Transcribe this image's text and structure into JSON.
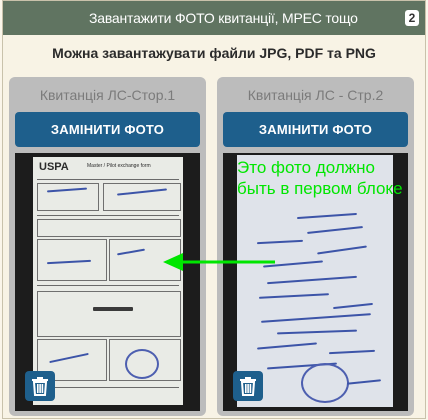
{
  "header": {
    "title": "Завантажити ФОТО квитанції, МРЕС тощо",
    "badge": "2"
  },
  "subtitle": "Можна завантажувати файли JPG, PDF та PNG",
  "cards": [
    {
      "label": "Квитанція ЛС-Стор.1",
      "button": "ЗАМІНИТИ ФОТО",
      "photo": {
        "logo": "USPA",
        "form_title": "Master / Pilot exchange form"
      }
    },
    {
      "label": "Квитанція ЛС - Стр.2",
      "button": "ЗАМІНИТИ ФОТО",
      "overlay_text": "Это фото должно быть в первом блоке"
    }
  ],
  "colors": {
    "header_bg": "#607461",
    "button_bg": "#1e5f8c",
    "card_bg": "#bcbcbc",
    "annotation": "#00e600"
  },
  "icons": {
    "delete": "trash-icon",
    "annotation_arrow": "arrow-left-icon"
  }
}
